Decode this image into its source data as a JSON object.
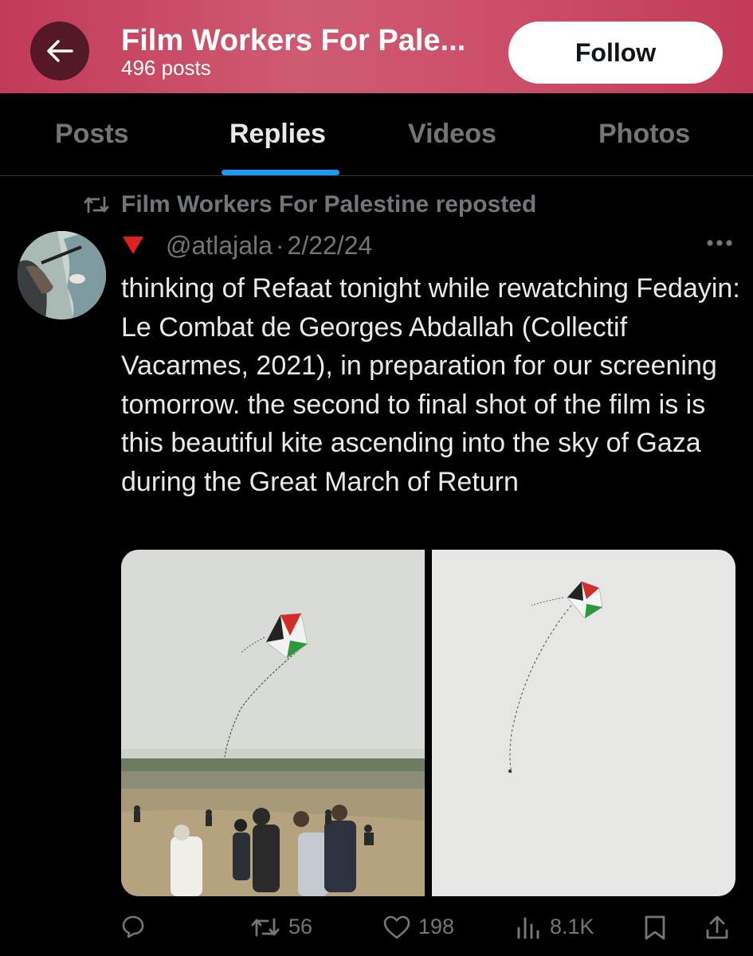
{
  "header": {
    "title": "Film Workers For Pale...",
    "post_count": "496 posts",
    "follow_label": "Follow"
  },
  "tabs": [
    {
      "label": "Posts",
      "active": false
    },
    {
      "label": "Replies",
      "active": true
    },
    {
      "label": "Videos",
      "active": false
    },
    {
      "label": "Photos",
      "active": false
    }
  ],
  "tweet": {
    "repost_label": "Film Workers For Palestine reposted",
    "flag": "🔻",
    "handle": "@atlajala",
    "separator": "·",
    "date": "2/22/24",
    "text": "thinking of Refaat tonight while rewatching Fedayin: Le Combat de Georges Abdallah (Collectif Vacarmes, 2021), in preparation for our screening tomorrow. the second to final shot of the film is is this beautiful kite ascending into the sky of Gaza during the Great March of Return",
    "media": [
      {
        "name": "kite-over-crowd"
      },
      {
        "name": "kite-in-sky"
      }
    ],
    "stats": {
      "reposts": "56",
      "likes": "198",
      "views": "8.1K"
    }
  },
  "colors": {
    "accent": "#1d9bf0",
    "muted": "#71767b",
    "header_bg": "#c94663",
    "flag_red": "#e0201f"
  },
  "icons": [
    "back-arrow-icon",
    "repost-icon",
    "more-icon",
    "reply-icon",
    "like-icon",
    "views-icon",
    "bookmark-icon",
    "share-icon"
  ]
}
